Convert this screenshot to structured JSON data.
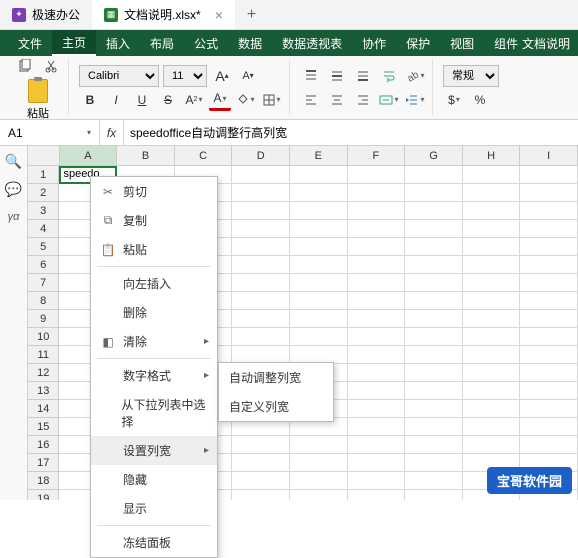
{
  "titlebar": {
    "app_name": "极速办公",
    "doc_tab": "文档说明.xlsx*",
    "plus": "+"
  },
  "doc_label_right": "文档说明",
  "menubar": {
    "items": [
      "文件",
      "主页",
      "插入",
      "布局",
      "公式",
      "数据",
      "数据透视表",
      "协作",
      "保护",
      "视图",
      "组件"
    ],
    "active_index": 1
  },
  "ribbon": {
    "paste_label": "粘贴",
    "font_name": "Calibri",
    "font_size": "11",
    "bold": "B",
    "italic": "I",
    "underline": "U",
    "strike": "S",
    "a_large": "A",
    "a_small": "A",
    "num_format": "常规"
  },
  "namebox": "A1",
  "fx": "fx",
  "formula": "speedoffice自动调整行高列宽",
  "columns": [
    "A",
    "B",
    "C",
    "D",
    "E",
    "F",
    "G",
    "H",
    "I"
  ],
  "selected_col_index": 0,
  "row_count": 20,
  "cell_a1": "speedoffice自动调整行高列宽",
  "context_menu": {
    "cut": "剪切",
    "copy": "复制",
    "paste": "粘贴",
    "insert_left": "向左插入",
    "delete": "删除",
    "clear": "清除",
    "num_format": "数字格式",
    "pick_from_list": "从下拉列表中选择",
    "set_col_width": "设置列宽",
    "hide": "隐藏",
    "show": "显示",
    "freeze": "冻结面板"
  },
  "submenu": {
    "auto_col_width": "自动调整列宽",
    "custom_col_width": "自定义列宽"
  },
  "watermark": "宝哥软件园"
}
